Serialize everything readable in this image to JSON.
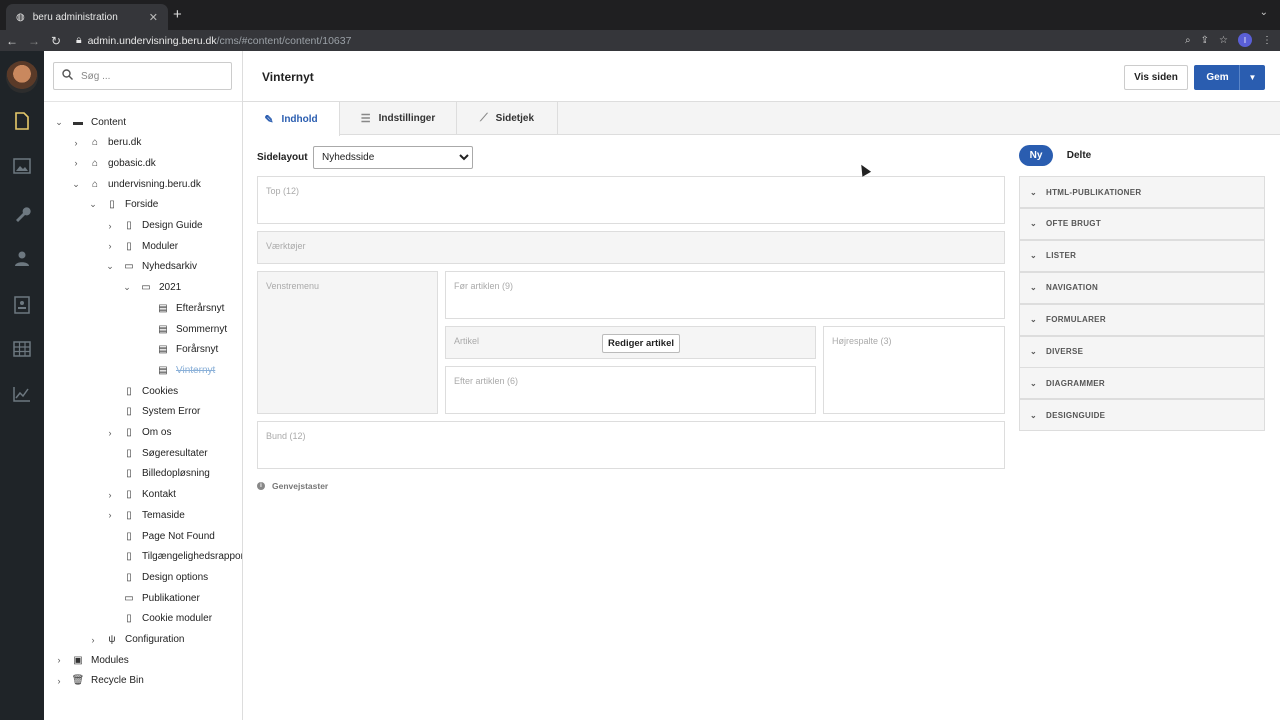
{
  "browser": {
    "tab_title": "beru administration",
    "tab_close": "✕",
    "new_tab": "+",
    "url_host": "admin.undervisning.beru.dk",
    "url_path": "/cms/#content/content/10637",
    "profile_initial": "I"
  },
  "sidebar": {
    "search_placeholder": "Søg ...",
    "tree": [
      {
        "label": "Content",
        "depth": 0,
        "expanded": true,
        "icon": "folder-icon"
      },
      {
        "label": "beru.dk",
        "depth": 1,
        "expanded": false,
        "icon": "home-icon"
      },
      {
        "label": "gobasic.dk",
        "depth": 1,
        "expanded": false,
        "icon": "home-icon"
      },
      {
        "label": "undervisning.beru.dk",
        "depth": 1,
        "expanded": true,
        "icon": "home-icon"
      },
      {
        "label": "Forside",
        "depth": 2,
        "expanded": true,
        "icon": "page-icon"
      },
      {
        "label": "Design Guide",
        "depth": 3,
        "expanded": false,
        "icon": "page-icon"
      },
      {
        "label": "Moduler",
        "depth": 3,
        "expanded": false,
        "icon": "page-icon"
      },
      {
        "label": "Nyhedsarkiv",
        "depth": 3,
        "expanded": true,
        "icon": "inbox-icon"
      },
      {
        "label": "2021",
        "depth": 4,
        "expanded": true,
        "icon": "inbox-icon"
      },
      {
        "label": "Efterårsnyt",
        "depth": 5,
        "icon": "news-icon"
      },
      {
        "label": "Sommernyt",
        "depth": 5,
        "icon": "news-icon"
      },
      {
        "label": "Forårsnyt",
        "depth": 5,
        "icon": "news-icon"
      },
      {
        "label": "Vinternyt",
        "depth": 5,
        "icon": "news-icon",
        "faded": true
      },
      {
        "label": "Cookies",
        "depth": 3,
        "icon": "page-icon"
      },
      {
        "label": "System Error",
        "depth": 3,
        "icon": "page-icon"
      },
      {
        "label": "Om os",
        "depth": 3,
        "expanded": false,
        "icon": "page-icon"
      },
      {
        "label": "Søgeresultater",
        "depth": 3,
        "icon": "page-icon"
      },
      {
        "label": "Billedopløsning",
        "depth": 3,
        "icon": "page-icon"
      },
      {
        "label": "Kontakt",
        "depth": 3,
        "expanded": false,
        "icon": "page-icon"
      },
      {
        "label": "Temaside",
        "depth": 3,
        "expanded": false,
        "icon": "page-icon"
      },
      {
        "label": "Page Not Found",
        "depth": 3,
        "icon": "page-icon"
      },
      {
        "label": "Tilgængelighedsrapport",
        "depth": 3,
        "icon": "page-icon"
      },
      {
        "label": "Design options",
        "depth": 3,
        "icon": "page-icon"
      },
      {
        "label": "Publikationer",
        "depth": 3,
        "icon": "inbox-icon"
      },
      {
        "label": "Cookie moduler",
        "depth": 3,
        "icon": "page-icon"
      },
      {
        "label": "Configuration",
        "depth": 2,
        "expanded": false,
        "icon": "plug-icon"
      },
      {
        "label": "Modules",
        "depth": 0,
        "expanded": false,
        "icon": "modules-icon"
      },
      {
        "label": "Recycle Bin",
        "depth": 0,
        "expanded": false,
        "icon": "trash-icon"
      }
    ]
  },
  "header": {
    "title": "Vinternyt",
    "view_button": "Vis siden",
    "save_button": "Gem"
  },
  "tabs": [
    {
      "label": "Indhold",
      "active": true
    },
    {
      "label": "Indstillinger",
      "active": false
    },
    {
      "label": "Sidetjek",
      "active": false
    }
  ],
  "layout": {
    "label": "Sidelayout",
    "selected": "Nyhedsside"
  },
  "zones": {
    "top": "Top (12)",
    "tools": "Værktøjer",
    "leftmenu": "Venstremenu",
    "before": "Før artiklen (9)",
    "article": "Artikel",
    "edit_article": "Rediger artikel",
    "after": "Efter artiklen (6)",
    "right": "Højrespalte (3)",
    "bottom": "Bund (12)"
  },
  "shortcuts": "Genvejstaster",
  "panel": {
    "tab_new": "Ny",
    "tab_shared": "Delte",
    "sections": [
      "HTML-PUBLIKATIONER",
      "OFTE BRUGT",
      "LISTER",
      "NAVIGATION",
      "FORMULARER",
      "DIVERSE",
      "DIAGRAMMER",
      "DESIGNGUIDE"
    ]
  },
  "colors": {
    "primary": "#2a5db0",
    "rail": "#1f2428",
    "rail_active": "#e6c96a"
  }
}
